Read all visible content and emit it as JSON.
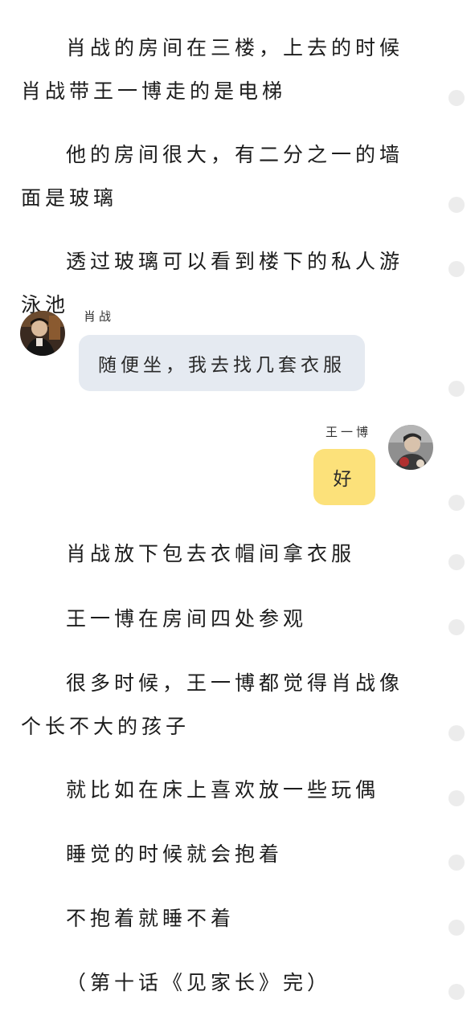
{
  "story": {
    "p1": "肖战的房间在三楼，上去的时候肖战带王一博走的是电梯",
    "p2": "他的房间很大，有二分之一的墙面是玻璃",
    "p3": "透过玻璃可以看到楼下的私人游泳池",
    "p4": "肖战放下包去衣帽间拿衣服",
    "p5": "王一博在房间四处参观",
    "p6": "很多时候，王一博都觉得肖战像个长不大的孩子",
    "p7": "就比如在床上喜欢放一些玩偶",
    "p8": "睡觉的时候就会抱着",
    "p9": "不抱着就睡不着",
    "p10": "（第十话《见家长》完）"
  },
  "chat": {
    "left": {
      "name": "肖战",
      "message": "随便坐，我去找几套衣服",
      "avatar": "avatar-xiao-zhan"
    },
    "right": {
      "name": "王一博",
      "message": "好",
      "avatar": "avatar-wang-yibo"
    }
  },
  "colors": {
    "left_bubble": "#e5eaf1",
    "right_bubble": "#fce17a",
    "comment_dot": "#ececec"
  },
  "icons": {
    "comment_marker": "comment-dot-icon"
  }
}
